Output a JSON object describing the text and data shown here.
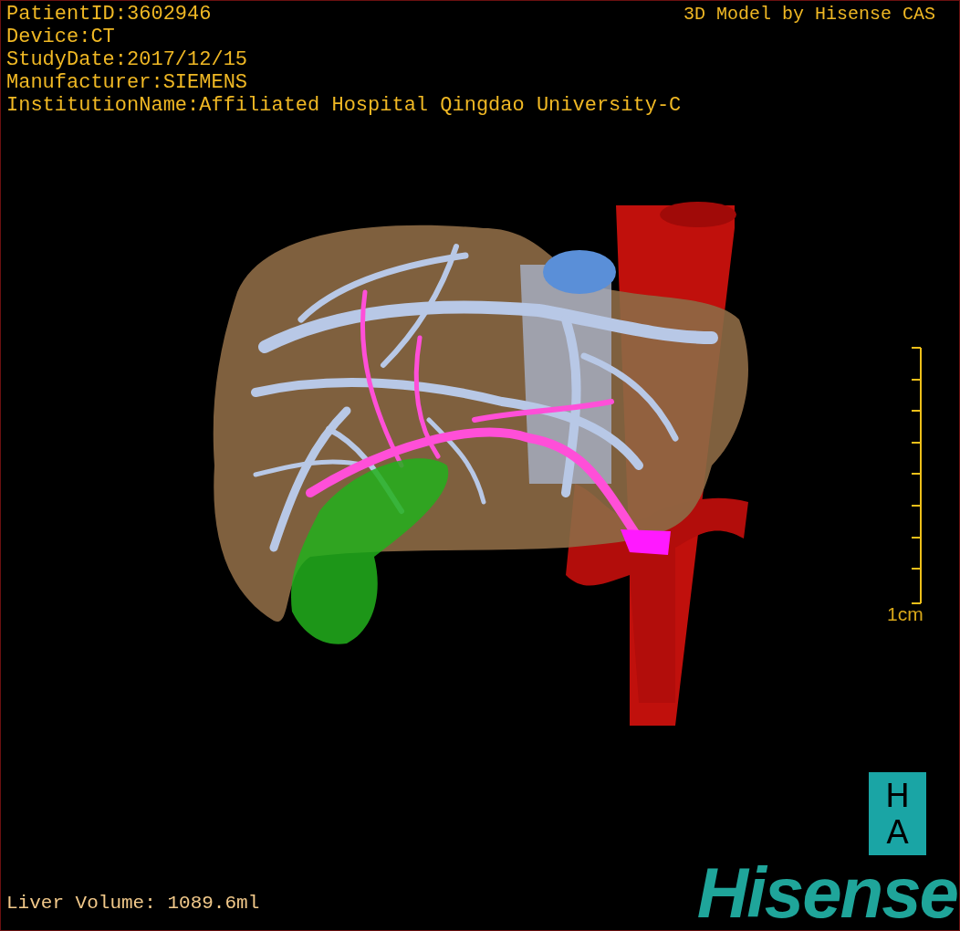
{
  "patient_info": [
    "PatientID:3602946",
    "Device:CT",
    "StudyDate:2017/12/15",
    "Manufacturer:SIEMENS",
    "InstitutionName:Affiliated Hospital Qingdao University-C"
  ],
  "title": "3D Model by Hisense CAS",
  "scale": {
    "label": "1cm"
  },
  "liver_volume": "Liver Volume: 1089.6ml",
  "logo": {
    "badge": [
      "H",
      "A"
    ],
    "wordmark": "Hisense"
  }
}
